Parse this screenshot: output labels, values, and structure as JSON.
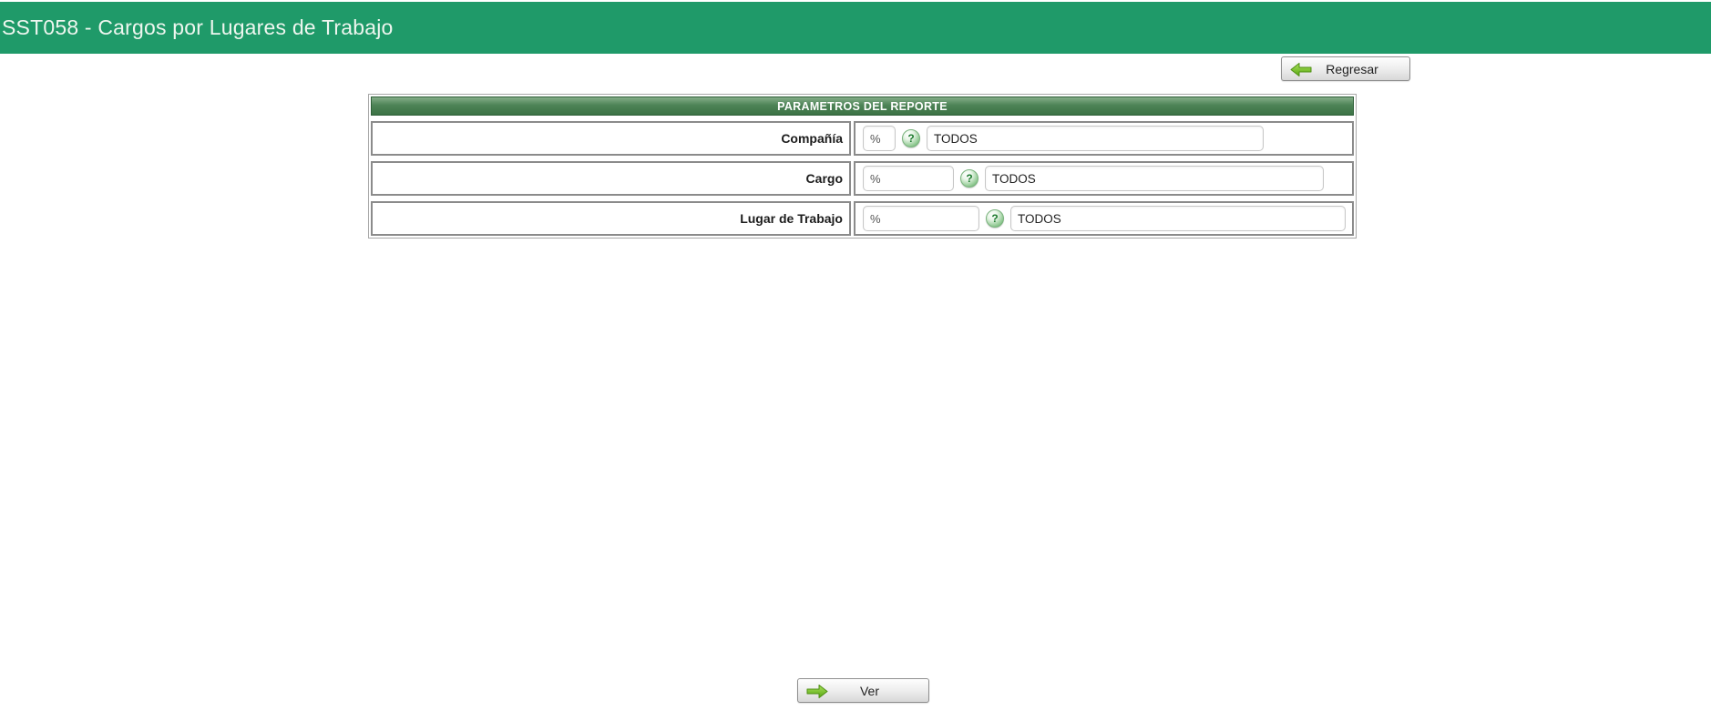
{
  "header": {
    "title": "SST058 - Cargos por Lugares de Trabajo"
  },
  "toolbar": {
    "regresar_label": "Regresar"
  },
  "form": {
    "title": "PARAMETROS DEL REPORTE",
    "rows": [
      {
        "label": "Compañía",
        "pattern": "%",
        "description": "TODOS"
      },
      {
        "label": "Cargo",
        "pattern": "%",
        "description": "TODOS"
      },
      {
        "label": "Lugar de Trabajo",
        "pattern": "%",
        "description": "TODOS"
      }
    ]
  },
  "icons": {
    "help_glyph": "?",
    "back_arrow": "left-arrow",
    "forward_arrow": "right-arrow"
  },
  "actions": {
    "ver_label": "Ver"
  },
  "colors": {
    "header_green": "#1f9a69",
    "band_green_dark": "#3c7345",
    "band_green_light": "#84ad88",
    "arrow_green": "#63b31a",
    "button_gray": "#e4e4e4"
  }
}
